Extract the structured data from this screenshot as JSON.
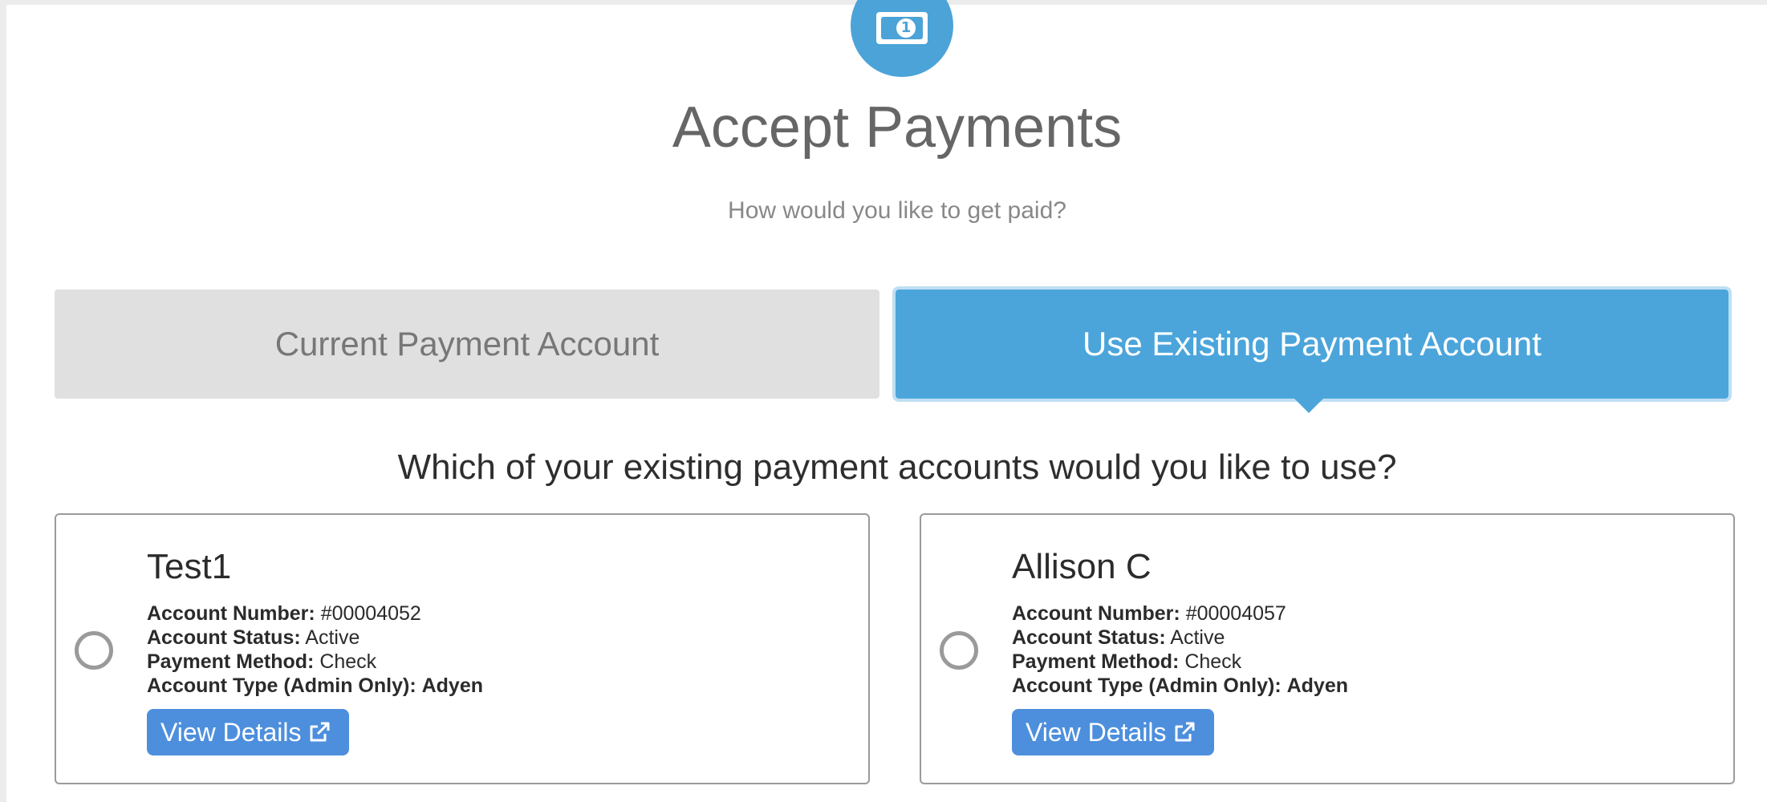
{
  "header": {
    "title": "Accept Payments",
    "subtitle": "How would you like to get paid?",
    "icon": "money-bill-icon",
    "icon_glyph": "1",
    "accent": "#4ba3d8"
  },
  "tabs": [
    {
      "label": "Current Payment Account",
      "selected": false
    },
    {
      "label": "Use Existing Payment Account",
      "selected": true
    }
  ],
  "question": "Which of your existing payment accounts would you like to use?",
  "labels": {
    "account_number": "Account Number:",
    "account_status": "Account Status:",
    "payment_method": "Payment Method:",
    "account_type": "Account Type (Admin Only):",
    "view_details": "View Details"
  },
  "accounts": [
    {
      "name": "Test1",
      "account_number": "#00004052",
      "status": "Active",
      "payment_method": "Check",
      "account_type": "Adyen",
      "selected": false
    },
    {
      "name": "Allison C",
      "account_number": "#00004057",
      "status": "Active",
      "payment_method": "Check",
      "account_type": "Adyen",
      "selected": false
    }
  ]
}
